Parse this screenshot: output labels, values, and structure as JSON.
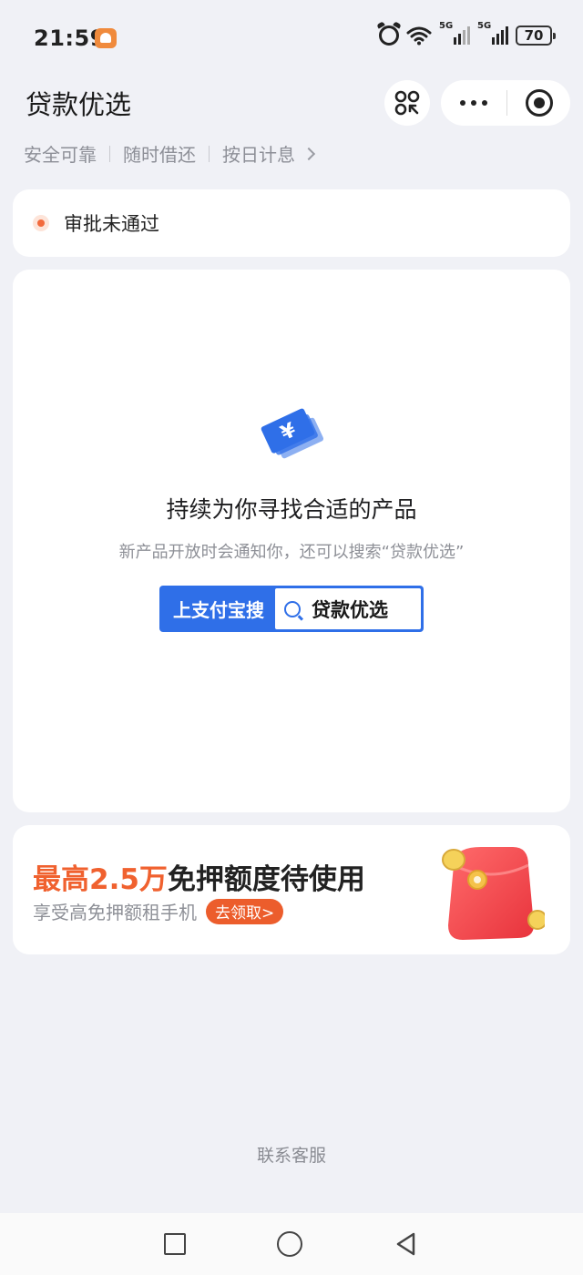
{
  "status_bar": {
    "time": "21:59",
    "signal1_label": "5G",
    "signal2_label": "5G",
    "battery": "70",
    "icons": [
      "app-notification-icon",
      "alarm-icon",
      "wifi-icon",
      "signal-icon",
      "signal-icon",
      "battery-icon"
    ]
  },
  "header": {
    "title": "贷款优选",
    "icons": [
      "scan-icon",
      "more-icon",
      "close-mini-program-icon"
    ]
  },
  "tags": [
    "安全可靠",
    "随时借还",
    "按日计息"
  ],
  "status_card": {
    "text": "审批未通过",
    "accent": "#f26a3d"
  },
  "main_card": {
    "title": "持续为你寻找合适的产品",
    "subtitle": "新产品开放时会通知你，还可以搜索“贷款优选”",
    "search_lead": "上支付宝搜",
    "search_value": "贷款优选",
    "accent": "#2f6fe8"
  },
  "promo": {
    "title_highlight": "最高2.5万",
    "title_rest": "免押额度待使用",
    "subtitle": "享受高免押额租手机",
    "cta": "去领取>",
    "accent": "#f0612f"
  },
  "footer": {
    "service_link": "联系客服"
  },
  "nav": [
    "recent-apps-icon",
    "home-icon",
    "back-icon"
  ]
}
